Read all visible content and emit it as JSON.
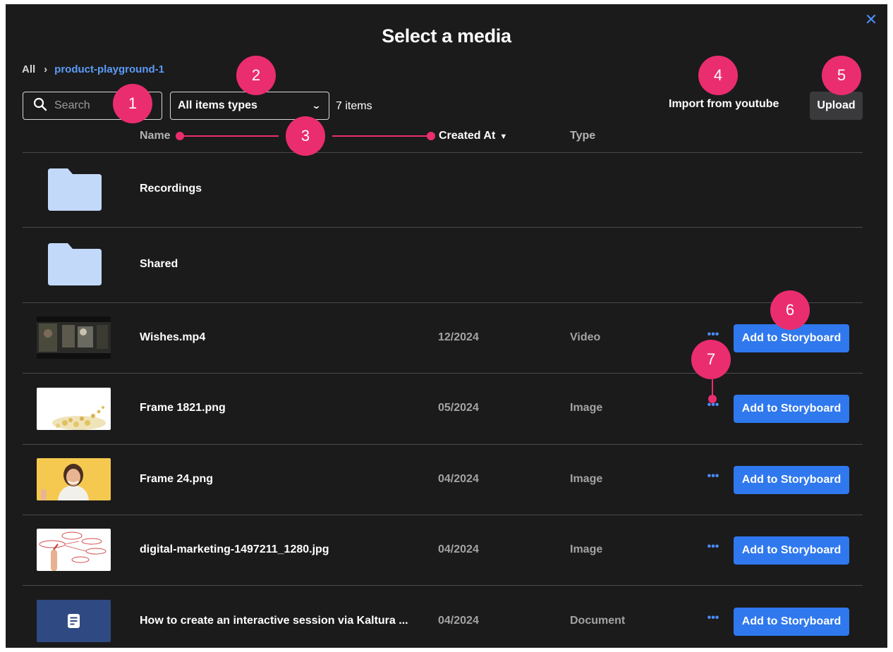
{
  "dialog": {
    "title": "Select a media",
    "close_glyph": "✕"
  },
  "breadcrumb": {
    "root": "All",
    "separator": "›",
    "current": "product-playground-1"
  },
  "toolbar": {
    "search_placeholder": "Search",
    "type_filter_selected": "All items types",
    "item_count": "7 items",
    "import_youtube_label": "Import from youtube",
    "upload_label": "Upload"
  },
  "columns": {
    "name": "Name",
    "created_at": "Created At",
    "type": "Type"
  },
  "folders": [
    {
      "name": "Recordings",
      "icon": "folder-icon"
    },
    {
      "name": "Shared",
      "icon": "folder-icon"
    }
  ],
  "items": [
    {
      "name": "Wishes.mp4",
      "date": "12/2024",
      "type": "Video",
      "thumbnail": "video-thumbnail"
    },
    {
      "name": "Frame 1821.png",
      "date": "05/2024",
      "type": "Image",
      "thumbnail": "image-thumbnail"
    },
    {
      "name": "Frame 24.png",
      "date": "04/2024",
      "type": "Image",
      "thumbnail": "image-thumbnail"
    },
    {
      "name": "digital-marketing-1497211_1280.jpg",
      "date": "04/2024",
      "type": "Image",
      "thumbnail": "image-thumbnail"
    },
    {
      "name": "How to create an interactive session via Kaltura ...",
      "date": "04/2024",
      "type": "Document",
      "thumbnail": "document-icon"
    }
  ],
  "row_actions": {
    "more_glyph": "•••",
    "add_label": "Add to Storyboard"
  },
  "annotations": [
    "1",
    "2",
    "3",
    "4",
    "5",
    "6",
    "7"
  ],
  "colors": {
    "dialog_bg": "#1b1b1c",
    "accent_blue": "#2f78ee",
    "link_blue": "#5c9bf6",
    "annotation_pink": "#ea2d6f",
    "folder_fill": "#c3d9fa"
  }
}
